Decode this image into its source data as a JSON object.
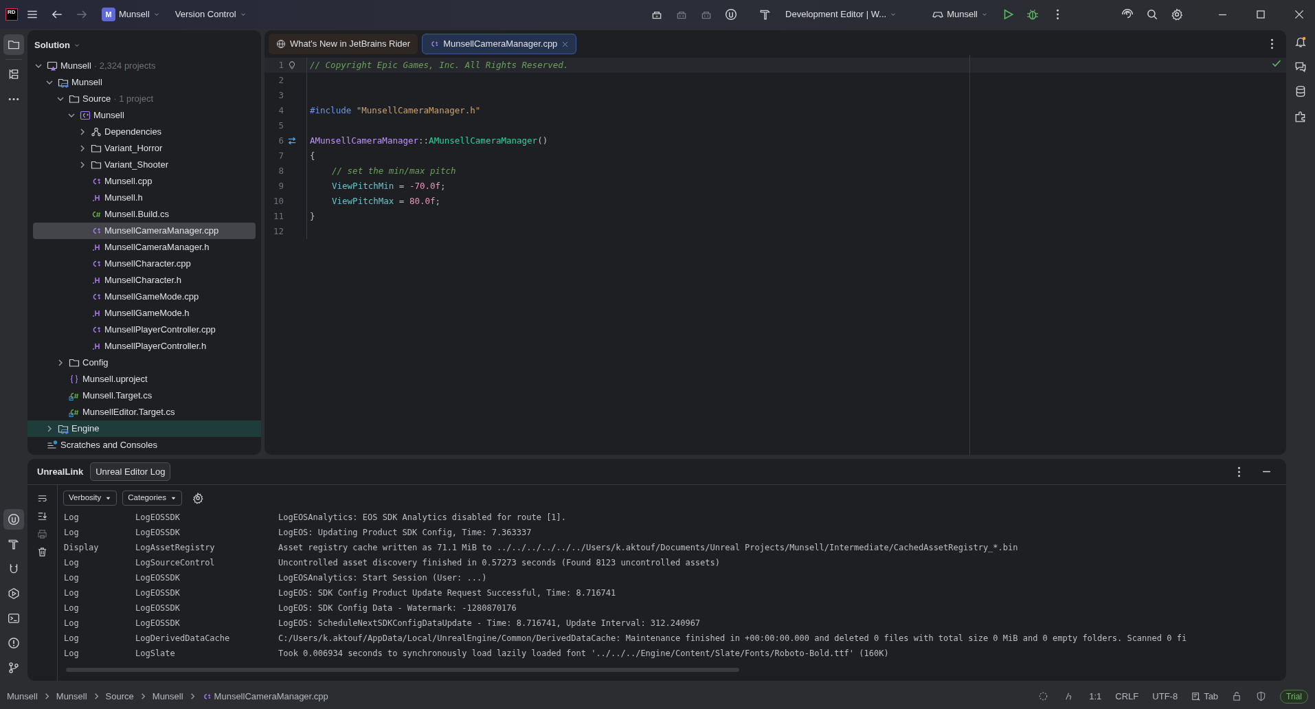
{
  "title_bar": {
    "logo": "RD",
    "project": {
      "badge": "M",
      "label": "Munsell"
    },
    "vcs": "Version Control",
    "run_target": "Development Editor | W...",
    "run_config": "Munsell"
  },
  "solution_panel": {
    "title": "Solution",
    "tree": [
      {
        "label": "Munsell",
        "suffix": "· 2,324 projects",
        "kind": "solution",
        "expanded": true,
        "selected": false,
        "hovered": false,
        "children": [
          {
            "label": "Munsell",
            "kind": "game",
            "expanded": true,
            "selected": false,
            "hovered": false,
            "children": [
              {
                "label": "Source",
                "suffix": "· 1 project",
                "kind": "folder",
                "expanded": true,
                "selected": false,
                "hovered": false,
                "children": [
                  {
                    "label": "Munsell",
                    "kind": "cppproject",
                    "expanded": true,
                    "selected": false,
                    "hovered": false,
                    "children": [
                      {
                        "label": "Dependencies",
                        "kind": "deps",
                        "expanded": false,
                        "selected": false,
                        "hovered": false
                      },
                      {
                        "label": "Variant_Horror",
                        "kind": "folder",
                        "expanded": false,
                        "selected": false,
                        "hovered": false
                      },
                      {
                        "label": "Variant_Shooter",
                        "kind": "folder",
                        "expanded": false,
                        "selected": false,
                        "hovered": false
                      },
                      {
                        "label": "Munsell.cpp",
                        "kind": "cpp",
                        "selected": false,
                        "hovered": false
                      },
                      {
                        "label": "Munsell.h",
                        "kind": "h",
                        "selected": false,
                        "hovered": false
                      },
                      {
                        "label": "Munsell.Build.cs",
                        "kind": "cs",
                        "selected": false,
                        "hovered": false
                      },
                      {
                        "label": "MunsellCameraManager.cpp",
                        "kind": "cpp",
                        "selected": true,
                        "hovered": false
                      },
                      {
                        "label": "MunsellCameraManager.h",
                        "kind": "h",
                        "selected": false,
                        "hovered": false
                      },
                      {
                        "label": "MunsellCharacter.cpp",
                        "kind": "cpp",
                        "selected": false,
                        "hovered": false
                      },
                      {
                        "label": "MunsellCharacter.h",
                        "kind": "h",
                        "selected": false,
                        "hovered": false
                      },
                      {
                        "label": "MunsellGameMode.cpp",
                        "kind": "cpp",
                        "selected": false,
                        "hovered": false
                      },
                      {
                        "label": "MunsellGameMode.h",
                        "kind": "h",
                        "selected": false,
                        "hovered": false
                      },
                      {
                        "label": "MunsellPlayerController.cpp",
                        "kind": "cpp",
                        "selected": false,
                        "hovered": false
                      },
                      {
                        "label": "MunsellPlayerController.h",
                        "kind": "h",
                        "selected": false,
                        "hovered": false
                      }
                    ]
                  }
                ]
              },
              {
                "label": "Config",
                "kind": "folder",
                "expanded": false,
                "selected": false,
                "hovered": false
              },
              {
                "label": "Munsell.uproject",
                "kind": "uproject",
                "selected": false,
                "hovered": false
              },
              {
                "label": "Munsell.Target.cs",
                "kind": "target",
                "selected": false,
                "hovered": false
              },
              {
                "label": "MunsellEditor.Target.cs",
                "kind": "target",
                "selected": false,
                "hovered": false
              }
            ]
          },
          {
            "label": "Engine",
            "kind": "game",
            "expanded": false,
            "selected": false,
            "hovered": true
          }
        ]
      },
      {
        "label": "Scratches and Consoles",
        "kind": "scratches",
        "selected": false,
        "hovered": false
      }
    ]
  },
  "editor": {
    "tabs": [
      {
        "label": "What's New in JetBrains Rider",
        "kind": "web",
        "selected": false,
        "closable": false
      },
      {
        "label": "MunsellCameraManager.cpp",
        "kind": "cpp",
        "selected": true,
        "closable": true
      }
    ],
    "lines": [
      {
        "number": "1",
        "kind": "hint",
        "current": true,
        "tokens": [
          {
            "kind": "comment",
            "text": "// Copyright Epic Games, Inc. All Rights Reserved."
          }
        ]
      },
      {
        "number": "2",
        "kind": "plain",
        "current": false
      },
      {
        "number": "3",
        "kind": "plain",
        "current": false
      },
      {
        "number": "4",
        "kind": "plain",
        "current": false,
        "tokens": [
          {
            "kind": "directive",
            "text": "#include"
          },
          {
            "kind": "string",
            "text": "\"MunsellCameraManager.h\""
          }
        ]
      },
      {
        "number": "5",
        "kind": "plain",
        "current": false
      },
      {
        "number": "6",
        "kind": "override",
        "current": false,
        "tokens": [
          {
            "kind": "class",
            "text": "AMunsellCameraManager"
          },
          {
            "kind": "plain",
            "text": "::"
          },
          {
            "kind": "method",
            "text": "AMunsellCameraManager"
          },
          {
            "kind": "plain",
            "text": "()"
          }
        ]
      },
      {
        "number": "7",
        "kind": "plain",
        "current": false,
        "tokens": [
          {
            "kind": "plain",
            "text": "{"
          }
        ]
      },
      {
        "number": "8",
        "kind": "plain",
        "current": false,
        "indented": true,
        "tokens": [
          {
            "kind": "comment",
            "text": "// set the min/max pitch"
          }
        ]
      },
      {
        "number": "9",
        "kind": "plain",
        "current": false,
        "indented": true,
        "tokens": [
          {
            "kind": "field",
            "text": "ViewPitchMin"
          },
          {
            "kind": "plain",
            "text": " = "
          },
          {
            "kind": "number",
            "text": "-70.0f"
          },
          {
            "kind": "plain",
            "text": ";"
          }
        ]
      },
      {
        "number": "10",
        "kind": "plain",
        "current": false,
        "indented": true,
        "tokens": [
          {
            "kind": "field",
            "text": "ViewPitchMax"
          },
          {
            "kind": "plain",
            "text": " = "
          },
          {
            "kind": "number",
            "text": "80.0f"
          },
          {
            "kind": "plain",
            "text": ";"
          }
        ]
      },
      {
        "number": "11",
        "kind": "plain",
        "current": false,
        "tokens": [
          {
            "kind": "plain",
            "text": "}"
          }
        ]
      },
      {
        "number": "12",
        "kind": "plain",
        "current": false
      }
    ]
  },
  "bottom_panel": {
    "title": "UnrealLink",
    "tabs": [
      {
        "label": "Unreal Editor Log",
        "selected": true
      }
    ],
    "filters": [
      "Verbosity",
      "Categories"
    ],
    "log_rows": [
      [
        "Log",
        "LogEOSSDK",
        "LogEOSAnalytics: EOS SDK Analytics disabled for route [1]."
      ],
      [
        "Log",
        "LogEOSSDK",
        "LogEOS: Updating Product SDK Config, Time: 7.363337"
      ],
      [
        "Display",
        "LogAssetRegistry",
        "Asset registry cache written as 71.1 MiB to ../../../../../../Users/k.aktouf/Documents/Unreal Projects/Munsell/Intermediate/CachedAssetRegistry_*.bin"
      ],
      [
        "Log",
        "LogSourceControl",
        "Uncontrolled asset discovery finished in 0.57273 seconds (Found 8123 uncontrolled assets)"
      ],
      [
        "Log",
        "LogEOSSDK",
        "LogEOSAnalytics: Start Session (User: ...)"
      ],
      [
        "Log",
        "LogEOSSDK",
        "LogEOS: SDK Config Product Update Request Successful, Time: 8.716741"
      ],
      [
        "Log",
        "LogEOSSDK",
        "LogEOS: SDK Config Data - Watermark: -1280870176"
      ],
      [
        "Log",
        "LogEOSSDK",
        "LogEOS: ScheduleNextSDKConfigDataUpdate - Time: 8.716741, Update Interval: 312.240967"
      ],
      [
        "Log",
        "LogDerivedDataCache",
        "C:/Users/k.aktouf/AppData/Local/UnrealEngine/Common/DerivedDataCache: Maintenance finished in +00:00:00.000 and deleted 0 files with total size 0 MiB and 0 empty folders. Scanned 0 fi"
      ],
      [
        "Log",
        "LogSlate",
        "Took 0.006934 seconds to synchronously load lazily loaded font '../../../Engine/Content/Slate/Fonts/Roboto-Bold.ttf' (160K)"
      ]
    ]
  },
  "status_bar": {
    "breadcrumbs": [
      {
        "label": "Munsell",
        "kind": "plain"
      },
      {
        "label": "Munsell",
        "kind": "plain"
      },
      {
        "label": "Source",
        "kind": "plain"
      },
      {
        "label": "Munsell",
        "kind": "plain"
      },
      {
        "label": "MunsellCameraManager.cpp",
        "kind": "cpp"
      }
    ],
    "position": "1:1",
    "line_separator": "CRLF",
    "encoding": "UTF-8",
    "indent": "Tab",
    "license": "Trial"
  }
}
